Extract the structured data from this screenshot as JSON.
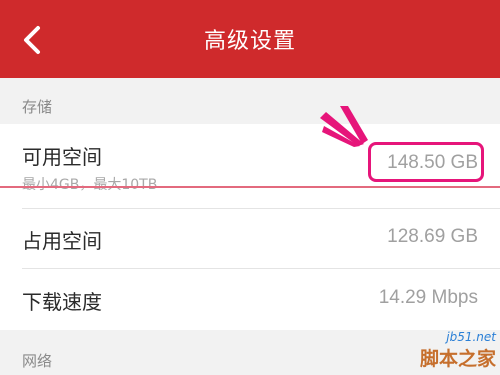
{
  "header": {
    "title": "高级设置",
    "background": "#cf2a2c",
    "back_icon": "chevron-left-icon"
  },
  "sections": {
    "storage_label": "存储",
    "network_label": "网络"
  },
  "rows": {
    "available_space": {
      "label": "可用空间",
      "sub": "最小4GB，最大10TB",
      "value": "148.50 GB"
    },
    "used_space": {
      "label": "占用空间",
      "value": "128.69 GB"
    },
    "download_speed": {
      "label": "下载速度",
      "value": "14.29 Mbps"
    }
  },
  "annotation": {
    "highlight_color": "#e6157a"
  },
  "watermark": {
    "url": "jb51.net",
    "name": "脚本之家"
  }
}
